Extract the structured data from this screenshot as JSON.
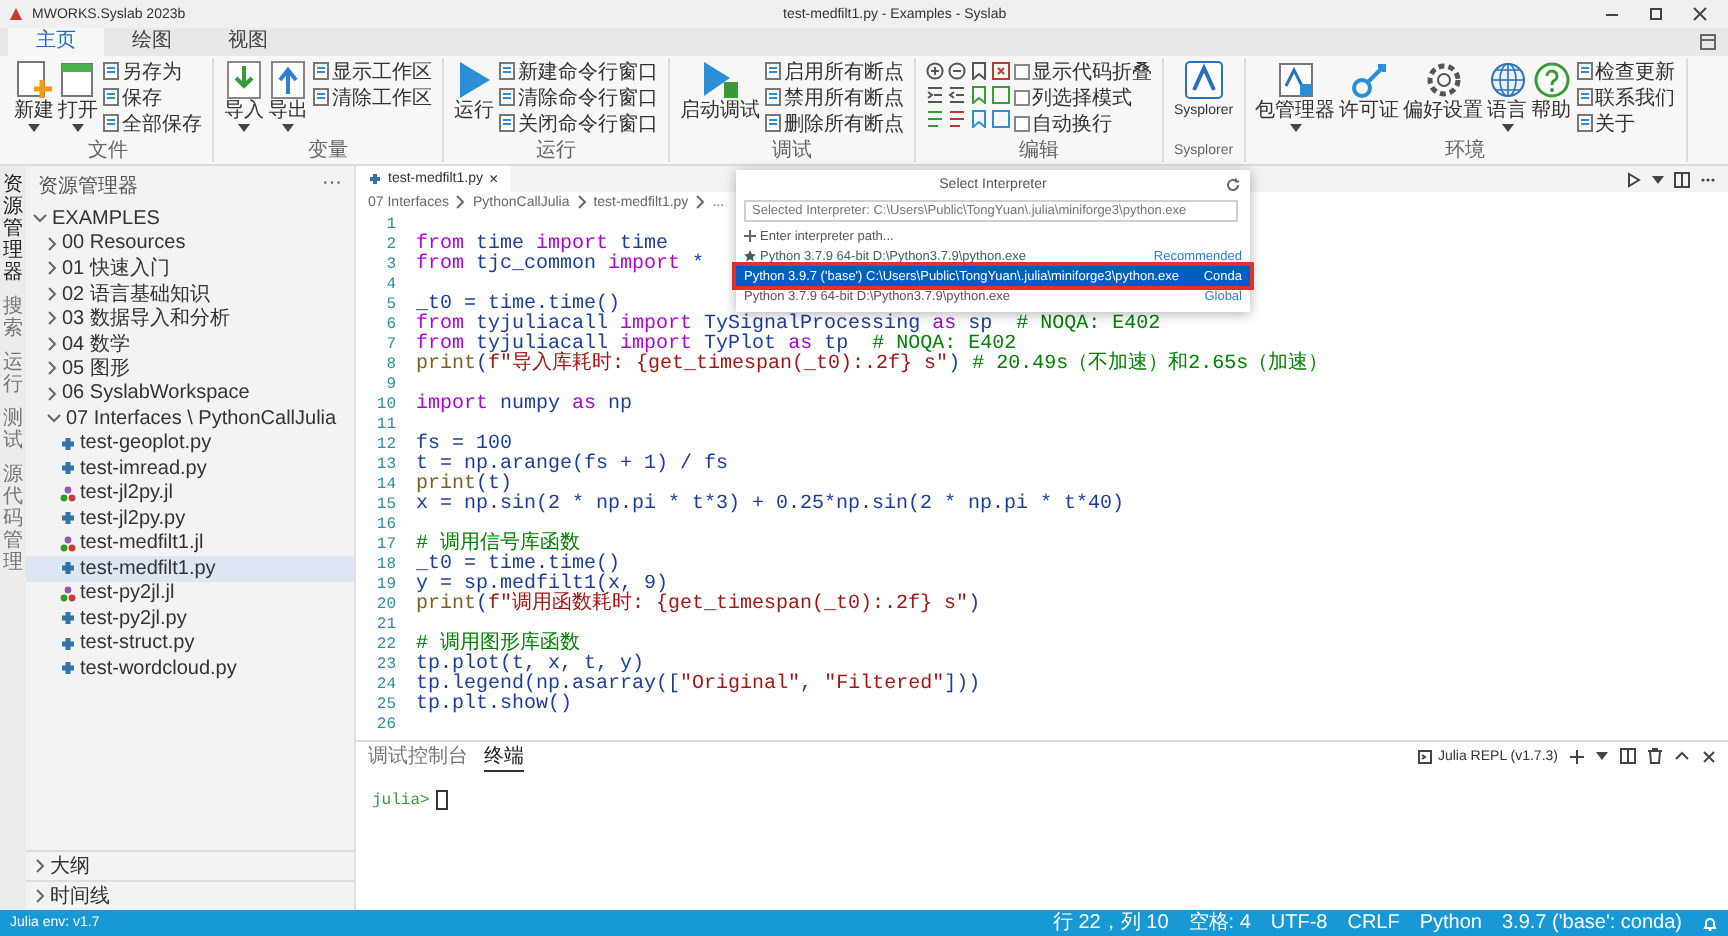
{
  "title_bar": {
    "app_title": "MWORKS.Syslab 2023b",
    "document_title": "test-medfilt1.py - Examples - Syslab"
  },
  "ribbon": {
    "tabs": [
      {
        "label": "主页",
        "selected": true
      },
      {
        "label": "绘图",
        "selected": false
      },
      {
        "label": "视图",
        "selected": false
      }
    ],
    "groups": [
      {
        "label": "文件",
        "items": [
          {
            "kind": "large",
            "label": "新建",
            "caret": true
          },
          {
            "kind": "large",
            "label": "打开",
            "caret": true
          },
          {
            "kind": "stack",
            "items": [
              {
                "kind": "action",
                "label": "另存为"
              },
              {
                "kind": "action",
                "label": "保存"
              },
              {
                "kind": "action",
                "label": "全部保存"
              }
            ]
          }
        ]
      },
      {
        "label": "变量",
        "items": [
          {
            "kind": "large",
            "label": "导入",
            "caret": true
          },
          {
            "kind": "large",
            "label": "导出",
            "caret": true
          },
          {
            "kind": "stack",
            "items": [
              {
                "kind": "action",
                "label": "显示工作区"
              },
              {
                "kind": "action",
                "label": "清除工作区"
              }
            ]
          }
        ]
      },
      {
        "label": "运行",
        "items": [
          {
            "kind": "large",
            "label": "运行",
            "caret": false
          },
          {
            "kind": "stack",
            "items": [
              {
                "kind": "action",
                "label": "新建命令行窗口"
              },
              {
                "kind": "action",
                "label": "清除命令行窗口"
              },
              {
                "kind": "action",
                "label": "关闭命令行窗口"
              }
            ]
          }
        ]
      },
      {
        "label": "调试",
        "items": [
          {
            "kind": "large",
            "label": "启动调试",
            "caret": false
          },
          {
            "kind": "stack",
            "items": [
              {
                "kind": "action",
                "label": "启用所有断点"
              },
              {
                "kind": "action",
                "label": "禁用所有断点"
              },
              {
                "kind": "action",
                "label": "删除所有断点"
              }
            ]
          }
        ]
      },
      {
        "label": "编辑",
        "items": [
          {
            "kind": "grid"
          },
          {
            "kind": "stack",
            "items": [
              {
                "kind": "check",
                "label": "显示代码折叠",
                "checked": false
              },
              {
                "kind": "check",
                "label": "列选择模式",
                "checked": false
              },
              {
                "kind": "check",
                "label": "自动换行",
                "checked": false
              }
            ]
          }
        ]
      },
      {
        "label": "Sysplorer",
        "items": [
          {
            "kind": "large",
            "label": "Sysplorer",
            "caret": false
          }
        ]
      },
      {
        "label": "环境",
        "items": [
          {
            "kind": "large",
            "label": "包管理器",
            "caret": true
          },
          {
            "kind": "large",
            "label": "许可证",
            "caret": false
          },
          {
            "kind": "large",
            "label": "偏好设置",
            "caret": false
          },
          {
            "kind": "large",
            "label": "语言",
            "caret": true
          },
          {
            "kind": "large",
            "label": "帮助",
            "caret": false
          },
          {
            "kind": "stack",
            "items": [
              {
                "kind": "action",
                "label": "检查更新"
              },
              {
                "kind": "action",
                "label": "联系我们"
              },
              {
                "kind": "action",
                "label": "关于"
              }
            ]
          }
        ]
      }
    ]
  },
  "activity_bar": [
    {
      "label": "资源管理器",
      "selected": true
    },
    {
      "label": "搜索",
      "selected": false
    },
    {
      "label": "运行",
      "selected": false
    },
    {
      "label": "测试",
      "selected": false
    },
    {
      "label": "源代码管理",
      "selected": false
    }
  ],
  "explorer": {
    "title": "资源管理器",
    "more": "···",
    "root": {
      "label": "EXAMPLES",
      "expanded": true,
      "children": [
        {
          "label": "00 Resources",
          "expanded": false
        },
        {
          "label": "01 快速入门",
          "expanded": false
        },
        {
          "label": "02 语言基础知识",
          "expanded": false
        },
        {
          "label": "03 数据导入和分析",
          "expanded": false
        },
        {
          "label": "04 数学",
          "expanded": false
        },
        {
          "label": "05 图形",
          "expanded": false
        },
        {
          "label": "06 SyslabWorkspace",
          "expanded": false
        },
        {
          "label": "07 Interfaces \\ PythonCallJulia",
          "expanded": true,
          "children": [
            {
              "label": "test-geoplot.py",
              "kind": "python",
              "selected": false
            },
            {
              "label": "test-imread.py",
              "kind": "python",
              "selected": false
            },
            {
              "label": "test-jl2py.jl",
              "kind": "julia",
              "selected": false
            },
            {
              "label": "test-jl2py.py",
              "kind": "python",
              "selected": false
            },
            {
              "label": "test-medfilt1.jl",
              "kind": "julia",
              "selected": false
            },
            {
              "label": "test-medfilt1.py",
              "kind": "python",
              "selected": true
            },
            {
              "label": "test-py2jl.jl",
              "kind": "julia",
              "selected": false
            },
            {
              "label": "test-py2jl.py",
              "kind": "python",
              "selected": false
            },
            {
              "label": "test-struct.py",
              "kind": "python",
              "selected": false
            },
            {
              "label": "test-wordcloud.py",
              "kind": "python",
              "selected": false
            }
          ]
        }
      ]
    },
    "sections": [
      {
        "label": "大纲",
        "expanded": false
      },
      {
        "label": "时间线",
        "expanded": false
      }
    ]
  },
  "editor": {
    "tabs": [
      {
        "label": "test-medfilt1.py",
        "selected": true,
        "close": "×"
      }
    ],
    "breadcrumb": [
      "07 Interfaces",
      "PythonCallJulia",
      "test-medfilt1.py",
      "..."
    ],
    "lines": [
      {
        "number": "1"
      },
      {
        "number": "2",
        "segments": [
          {
            "kind": "kw",
            "text": "from "
          },
          {
            "kind": "plain",
            "text": "time "
          },
          {
            "kind": "kw",
            "text": "import "
          },
          {
            "kind": "plain",
            "text": "time"
          }
        ]
      },
      {
        "number": "3",
        "segments": [
          {
            "kind": "kw",
            "text": "from "
          },
          {
            "kind": "plain",
            "text": "tjc_common "
          },
          {
            "kind": "kw",
            "text": "import "
          },
          {
            "kind": "plain",
            "text": "*"
          }
        ]
      },
      {
        "number": "4"
      },
      {
        "number": "5",
        "segments": [
          {
            "kind": "plain",
            "text": "_t0 = time.time()"
          }
        ]
      },
      {
        "number": "6",
        "segments": [
          {
            "kind": "kw",
            "text": "from "
          },
          {
            "kind": "plain",
            "text": "tyjuliacall "
          },
          {
            "kind": "kw",
            "text": "import "
          },
          {
            "kind": "plain",
            "text": "TySignalProcessing "
          },
          {
            "kind": "kw",
            "text": "as "
          },
          {
            "kind": "plain",
            "text": "sp  "
          },
          {
            "kind": "comment",
            "text": "# NOQA: E402"
          }
        ]
      },
      {
        "number": "7",
        "segments": [
          {
            "kind": "kw",
            "text": "from "
          },
          {
            "kind": "plain",
            "text": "tyjuliacall "
          },
          {
            "kind": "kw",
            "text": "import "
          },
          {
            "kind": "plain",
            "text": "TyPlot "
          },
          {
            "kind": "kw",
            "text": "as "
          },
          {
            "kind": "plain",
            "text": "tp  "
          },
          {
            "kind": "comment",
            "text": "# NOQA: E402"
          }
        ]
      },
      {
        "number": "8",
        "segments": [
          {
            "kind": "fn",
            "text": "print"
          },
          {
            "kind": "plain",
            "text": "("
          },
          {
            "kind": "str",
            "text": "f\"导入库耗时: {get_timespan(_t0):.2f} s\""
          },
          {
            "kind": "plain",
            "text": ") "
          },
          {
            "kind": "comment",
            "text": "# 20.49s（不加速）和2.65s（加速）"
          }
        ]
      },
      {
        "number": "9"
      },
      {
        "number": "10",
        "segments": [
          {
            "kind": "kw",
            "text": "import "
          },
          {
            "kind": "plain",
            "text": "numpy "
          },
          {
            "kind": "kw",
            "text": "as "
          },
          {
            "kind": "plain",
            "text": "np"
          }
        ]
      },
      {
        "number": "11"
      },
      {
        "number": "12",
        "segments": [
          {
            "kind": "plain",
            "text": "fs = 100"
          }
        ]
      },
      {
        "number": "13",
        "segments": [
          {
            "kind": "plain",
            "text": "t = np.arange(fs + 1) / fs"
          }
        ]
      },
      {
        "number": "14",
        "segments": [
          {
            "kind": "fn",
            "text": "print"
          },
          {
            "kind": "plain",
            "text": "(t)"
          }
        ]
      },
      {
        "number": "15",
        "segments": [
          {
            "kind": "plain",
            "text": "x = np.sin(2 * np.pi * t*3) + 0.25*np.sin(2 * np.pi * t*40)"
          }
        ]
      },
      {
        "number": "16"
      },
      {
        "number": "17",
        "segments": [
          {
            "kind": "comment",
            "text": "# 调用信号库函数"
          }
        ]
      },
      {
        "number": "18",
        "segments": [
          {
            "kind": "plain",
            "text": "_t0 = time.time()"
          }
        ]
      },
      {
        "number": "19",
        "segments": [
          {
            "kind": "plain",
            "text": "y = sp.medfilt1(x, 9)"
          }
        ]
      },
      {
        "number": "20",
        "segments": [
          {
            "kind": "fn",
            "text": "print"
          },
          {
            "kind": "plain",
            "text": "("
          },
          {
            "kind": "str",
            "text": "f\"调用函数耗时: {get_timespan(_t0):.2f} s\""
          },
          {
            "kind": "plain",
            "text": ")"
          }
        ]
      },
      {
        "number": "21"
      },
      {
        "number": "22",
        "segments": [
          {
            "kind": "comment",
            "text": "# 调用图形库函数"
          }
        ]
      },
      {
        "number": "23",
        "segments": [
          {
            "kind": "plain",
            "text": "tp.plot(t, x, t, y)"
          }
        ]
      },
      {
        "number": "24",
        "segments": [
          {
            "kind": "plain",
            "text": "tp.legend(np.asarray(["
          },
          {
            "kind": "str",
            "text": "\"Original\""
          },
          {
            "kind": "plain",
            "text": ", "
          },
          {
            "kind": "str",
            "text": "\"Filtered\""
          },
          {
            "kind": "plain",
            "text": "]))"
          }
        ]
      },
      {
        "number": "25",
        "segments": [
          {
            "kind": "plain",
            "text": "tp.plt.show()"
          }
        ]
      },
      {
        "number": "26"
      }
    ]
  },
  "interpreter_picker": {
    "title": "Select Interpreter",
    "placeholder": "Selected Interpreter: C:\\Users\\Public\\TongYuan\\.julia\\miniforge3\\python.exe",
    "items": [
      {
        "kind": "action",
        "label": "Enter interpreter path...",
        "selected": false
      },
      {
        "kind": "interpreter",
        "label": "Python 3.7.9 64-bit  D:\\Python3.7.9\\python.exe",
        "tag": "Recommended",
        "starred": true,
        "selected": false
      },
      {
        "kind": "interpreter",
        "label": "Python 3.9.7 ('base')  C:\\Users\\Public\\TongYuan\\.julia\\miniforge3\\python.exe",
        "tag": "Conda",
        "starred": false,
        "selected": true
      },
      {
        "kind": "interpreter",
        "label": "Python 3.7.9 64-bit  D:\\Python3.7.9\\python.exe",
        "tag": "Global",
        "starred": false,
        "selected": false
      }
    ]
  },
  "panel": {
    "tabs": [
      {
        "label": "调试控制台",
        "selected": false
      },
      {
        "label": "终端",
        "selected": true
      }
    ],
    "terminal_name": "Julia REPL (v1.7.3)",
    "prompt": "julia>"
  },
  "status_bar": {
    "left": "Julia env: v1.7",
    "right": [
      "行 22，列 10",
      "空格: 4",
      "UTF-8",
      "CRLF",
      "Python",
      "3.9.7 ('base': conda)"
    ]
  }
}
